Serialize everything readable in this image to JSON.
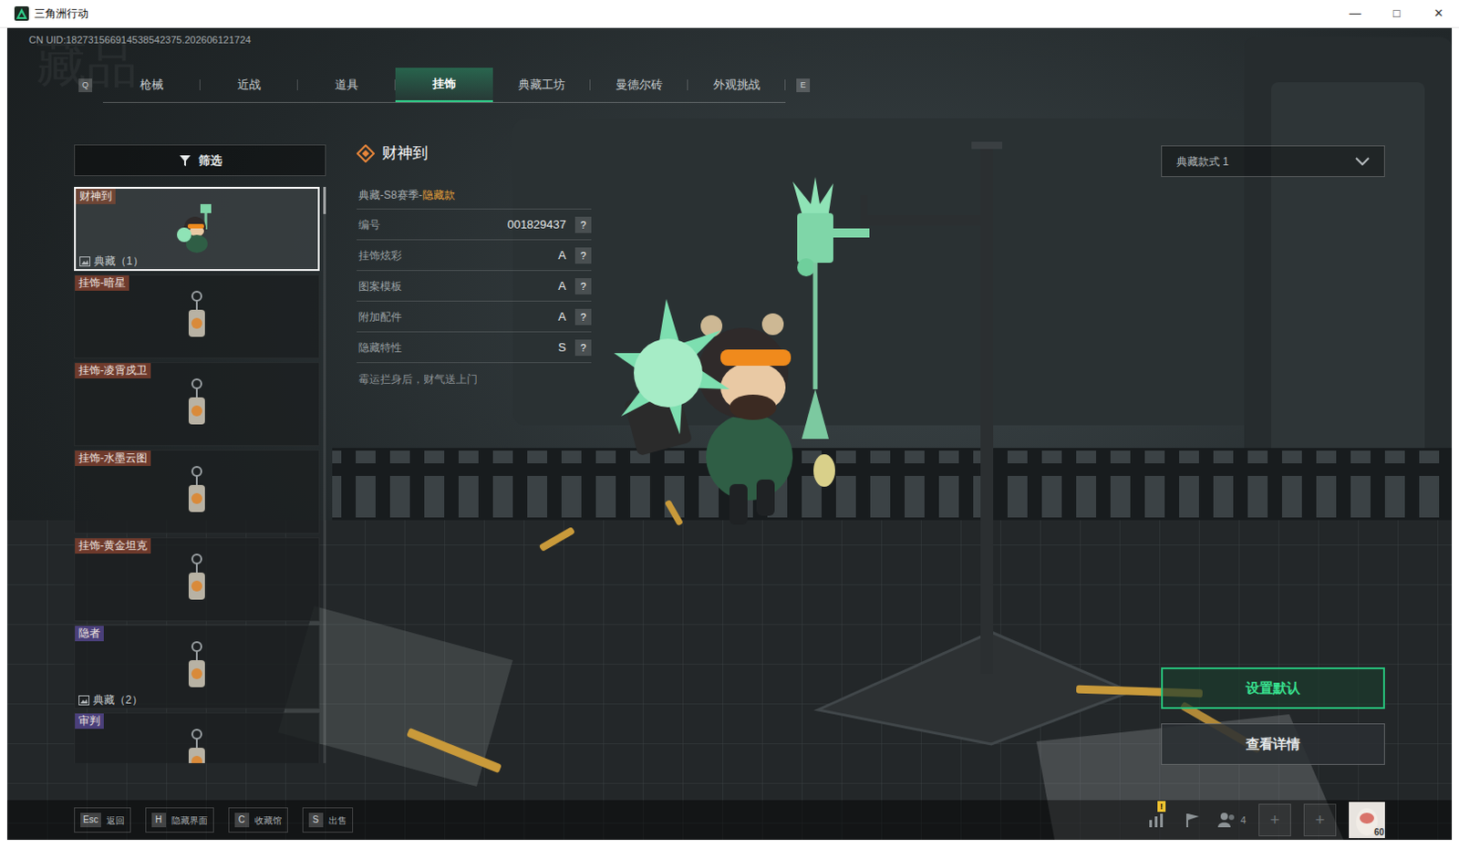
{
  "window": {
    "title": "三角洲行动",
    "controls": [
      "—",
      "□",
      "✕"
    ]
  },
  "uid": "CN UID:182731566914538542375.202606121724",
  "watermark": "藏品",
  "tabs": {
    "prev_key": "Q",
    "next_key": "E",
    "items": [
      {
        "label": "枪械",
        "selected": false
      },
      {
        "label": "近战",
        "selected": false
      },
      {
        "label": "道具",
        "selected": false
      },
      {
        "label": "挂饰",
        "selected": true
      },
      {
        "label": "典藏工坊",
        "selected": false
      },
      {
        "label": "曼德尔砖",
        "selected": false
      },
      {
        "label": "外观挑战",
        "selected": false
      }
    ]
  },
  "filter": {
    "label": "筛选"
  },
  "items": [
    {
      "tag": "财神到",
      "color": "#6e4535",
      "badge": "典藏（1）",
      "selected": true
    },
    {
      "tag": "挂饰-暗星",
      "color": "#6e3a2c",
      "badge": "",
      "selected": false
    },
    {
      "tag": "挂饰-凌霄戍卫",
      "color": "#6e3a2c",
      "badge": "",
      "selected": false
    },
    {
      "tag": "挂饰-水墨云图",
      "color": "#6e3a2c",
      "badge": "",
      "selected": false
    },
    {
      "tag": "挂饰-黄金坦克",
      "color": "#6e3a2c",
      "badge": "",
      "selected": false
    },
    {
      "tag": "隐者",
      "color": "#4a3f7a",
      "badge": "典藏（2）",
      "selected": false
    },
    {
      "tag": "审判",
      "color": "#4a3f7a",
      "badge": "",
      "selected": false
    }
  ],
  "detail": {
    "title": "财神到",
    "category": "典藏-S8赛季-",
    "rarity": "隐藏款",
    "attributes": [
      {
        "label": "编号",
        "value": "001829437",
        "help": "?"
      },
      {
        "label": "挂饰炫彩",
        "value": "A",
        "help": "?"
      },
      {
        "label": "图案模板",
        "value": "A",
        "help": "?"
      },
      {
        "label": "附加配件",
        "value": "A",
        "help": "?"
      },
      {
        "label": "隐藏特性",
        "value": "S",
        "help": "?"
      }
    ],
    "description": "霉运拦身后，财气送上门"
  },
  "style_select": {
    "value": "典藏款式 1"
  },
  "buttons": [
    {
      "label": "设置默认",
      "primary": true
    },
    {
      "label": "查看详情",
      "primary": false
    }
  ],
  "hints": [
    {
      "key": "Esc",
      "label": "返回"
    },
    {
      "key": "H",
      "label": "隐藏界面"
    },
    {
      "key": "C",
      "label": "收藏馆"
    },
    {
      "key": "S",
      "label": "出售"
    }
  ],
  "status": {
    "alert": "!",
    "party_count": "4",
    "slots": [
      "+",
      "+"
    ],
    "level": "60"
  }
}
